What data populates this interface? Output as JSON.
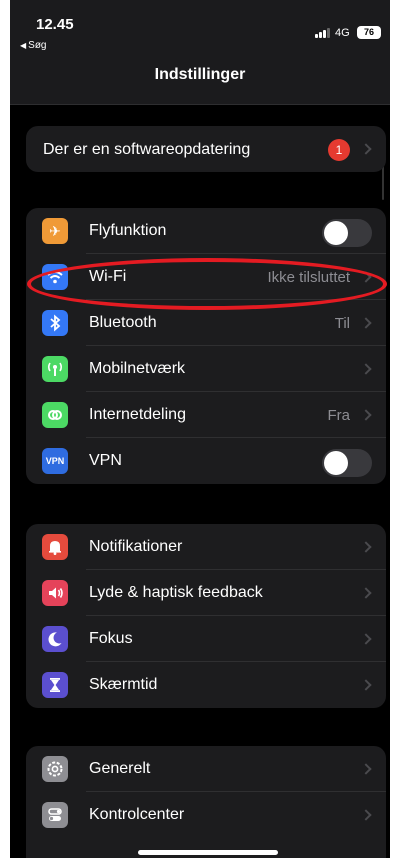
{
  "status_bar": {
    "time": "12.45",
    "back_label": "Søg",
    "network": "4G",
    "battery": "76"
  },
  "nav": {
    "title": "Indstillinger"
  },
  "update_banner": {
    "label": "Der er en softwareopdatering",
    "badge_count": "1",
    "badge_color": "#e53a30"
  },
  "connectivity": [
    {
      "name": "Flyfunktion",
      "icon": "airplane-icon",
      "color": "#f09a37",
      "control": "toggle",
      "on": false
    },
    {
      "name": "Wi-Fi",
      "icon": "wifi-icon",
      "color": "#3478f6",
      "value": "Ikke tilsluttet",
      "control": "chevron"
    },
    {
      "name": "Bluetooth",
      "icon": "bluetooth-icon",
      "color": "#3478f6",
      "value": "Til",
      "control": "chevron"
    },
    {
      "name": "Mobilnetværk",
      "icon": "antenna-icon",
      "color": "#4cd964",
      "control": "chevron"
    },
    {
      "name": "Internetdeling",
      "icon": "hotspot-icon",
      "color": "#4cd964",
      "value": "Fra",
      "control": "chevron"
    },
    {
      "name": "VPN",
      "icon": "vpn-icon",
      "icon_text": "VPN",
      "color": "#2f6ce0",
      "control": "toggle",
      "on": false
    }
  ],
  "notifications": [
    {
      "name": "Notifikationer",
      "icon": "bell-icon",
      "color": "#e54b3d"
    },
    {
      "name": "Lyde & haptisk feedback",
      "icon": "speaker-icon",
      "color": "#e5435a"
    },
    {
      "name": "Fokus",
      "icon": "moon-icon",
      "color": "#5b4fcf"
    },
    {
      "name": "Skærmtid",
      "icon": "hourglass-icon",
      "color": "#5b4fcf"
    }
  ],
  "general": [
    {
      "name": "Generelt",
      "icon": "gear-icon",
      "color": "#8e8e93"
    },
    {
      "name": "Kontrolcenter",
      "icon": "switches-icon",
      "color": "#8e8e93"
    }
  ],
  "highlight_color": "#e41b22"
}
